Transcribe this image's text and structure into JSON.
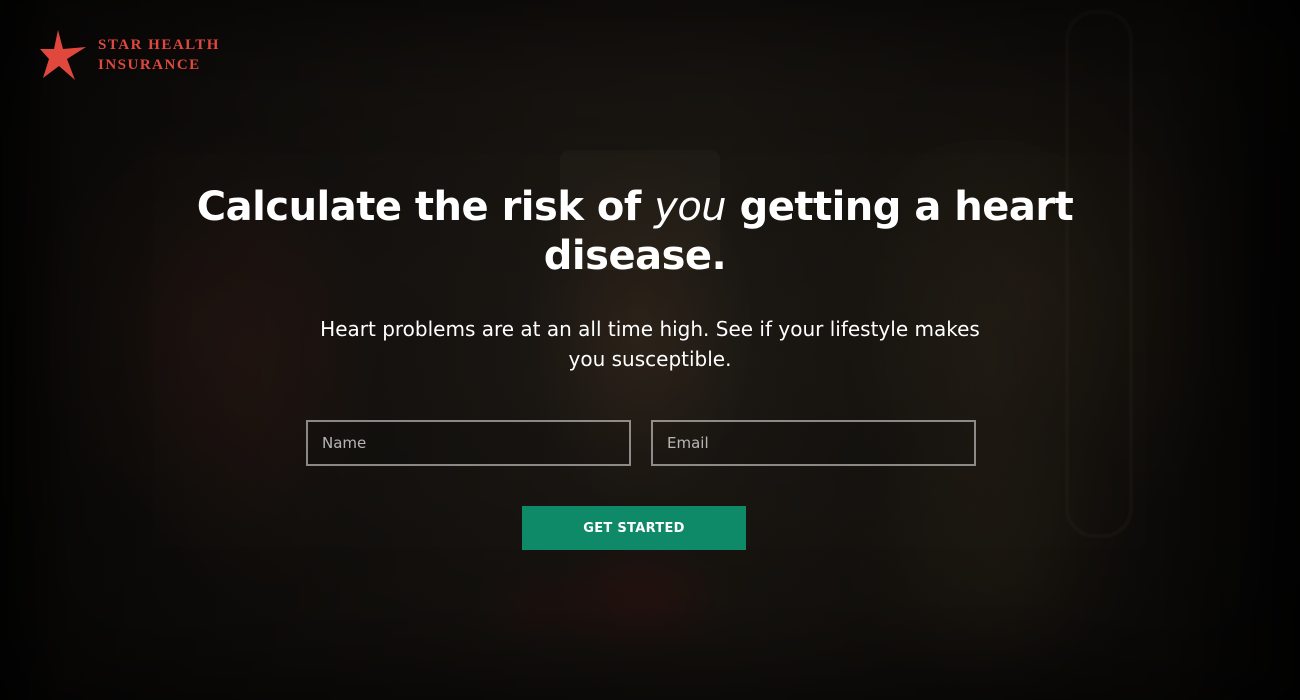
{
  "brand": {
    "line1": "STAR HEALTH",
    "line2": "INSURANCE",
    "accent_color": "#e0483e",
    "logo_icon": "star-icon"
  },
  "hero": {
    "headline_before": "Calculate the risk of ",
    "headline_emphasis": "you",
    "headline_after": " getting a heart disease.",
    "subheadline": "Heart problems are at an all time high. See if your lifestyle makes you susceptible."
  },
  "form": {
    "name_placeholder": "Name",
    "name_value": "",
    "email_placeholder": "Email",
    "email_value": "",
    "submit_label": "GET STARTED",
    "submit_color": "#0e8a68"
  }
}
